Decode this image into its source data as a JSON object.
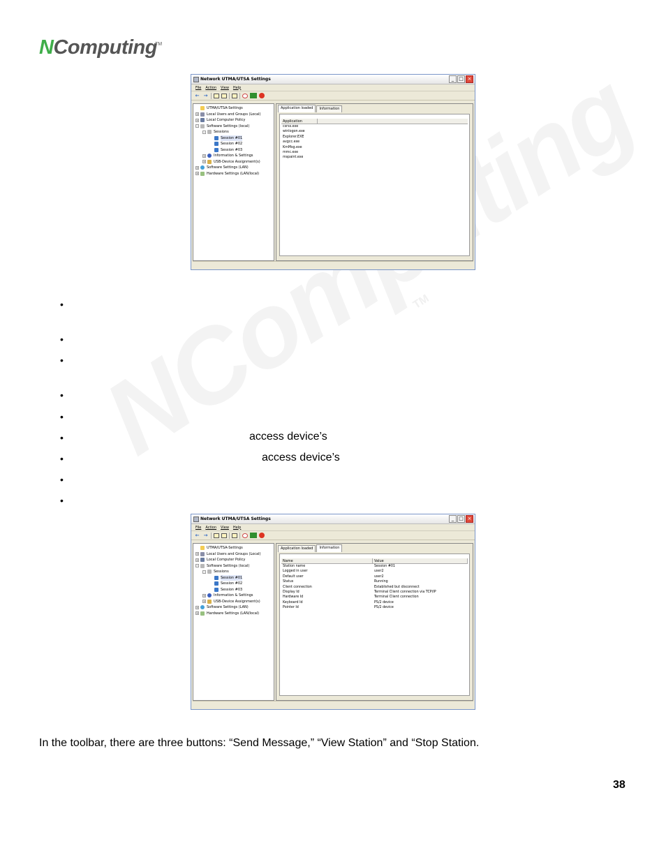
{
  "logo": {
    "n": "N",
    "text": "Computing",
    "tm": "TM"
  },
  "watermark": {
    "text": "NComputing",
    "tm": "TM"
  },
  "window": {
    "title": "Network UTMA/UTSA Settings",
    "menu": [
      "File",
      "Action",
      "View",
      "Help"
    ],
    "controls": {
      "minimize": "_",
      "maximize": "□",
      "close": "×"
    },
    "tree": [
      {
        "label": "UTMA/UTSA-Settings",
        "icon": "folder-icon",
        "level": 0,
        "expander": ""
      },
      {
        "label": "Local Users and Groups (Local)",
        "icon": "users-icon",
        "level": 0,
        "expander": "+"
      },
      {
        "label": "Local Computer Policy",
        "icon": "policy-icon",
        "level": 0,
        "expander": "+"
      },
      {
        "label": "Software Settings (local)",
        "icon": "software-icon",
        "level": 0,
        "expander": "-"
      },
      {
        "label": "Sessions",
        "icon": "sessions-icon",
        "level": 1,
        "expander": "-"
      },
      {
        "label": "Session #01",
        "icon": "session-icon",
        "level": 2,
        "expander": "",
        "selected": true
      },
      {
        "label": "Session #02",
        "icon": "session-icon",
        "level": 2,
        "expander": ""
      },
      {
        "label": "Session #03",
        "icon": "session-icon",
        "level": 2,
        "expander": ""
      },
      {
        "label": "Information & Settings",
        "icon": "info-icon",
        "level": 1,
        "expander": "+"
      },
      {
        "label": "USB-Device Assignment(s)",
        "icon": "usb-icon",
        "level": 1,
        "expander": "+"
      },
      {
        "label": "Software Settings (LAN)",
        "icon": "lan-icon",
        "level": 0,
        "expander": "+"
      },
      {
        "label": "Hardware Settings (LAN/local)",
        "icon": "hardware-icon",
        "level": 0,
        "expander": "+"
      }
    ],
    "tabs": [
      "Application loaded",
      "Information"
    ]
  },
  "window1": {
    "active_tab": 0,
    "columns": [
      "Application"
    ],
    "rows": [
      "csrss.exe",
      "winlogon.exe",
      "Explorer.EXE",
      "avgcc.exe",
      "KmMsg.exe",
      "mmc.exe",
      "mspaint.exe"
    ]
  },
  "window2": {
    "active_tab": 1,
    "columns": [
      "Name",
      "Value"
    ],
    "rows": [
      [
        "Station name",
        "Session #01"
      ],
      [
        "Logged in user",
        "user2"
      ],
      [
        "Default user",
        "user2"
      ],
      [
        "Status",
        "Running"
      ],
      [
        "Client connection",
        "Established but disconnect"
      ],
      [
        "Display Id",
        "Terminal Client connection via TCP/IP"
      ],
      [
        "Hardware Id",
        "Terminal Client connection"
      ],
      [
        "Keyboard Id",
        "PS/2 device"
      ],
      [
        "Pointer Id",
        "PS/2 device"
      ]
    ]
  },
  "bullets": [
    {
      "bullet": "•",
      "text": ""
    },
    {
      "bullet": "•",
      "text": ""
    },
    {
      "bullet": "•",
      "text": ""
    },
    {
      "bullet": "•",
      "text": ""
    },
    {
      "bullet": "•",
      "text": ""
    },
    {
      "bullet": "•",
      "text": "access device’s"
    },
    {
      "bullet": "•",
      "text": "access device’s"
    },
    {
      "bullet": "•",
      "text": ""
    },
    {
      "bullet": "•",
      "text": ""
    }
  ],
  "paragraph": "In the toolbar, there are three buttons: “Send Message,” “View Station” and “Stop Station.",
  "page_number": "38"
}
